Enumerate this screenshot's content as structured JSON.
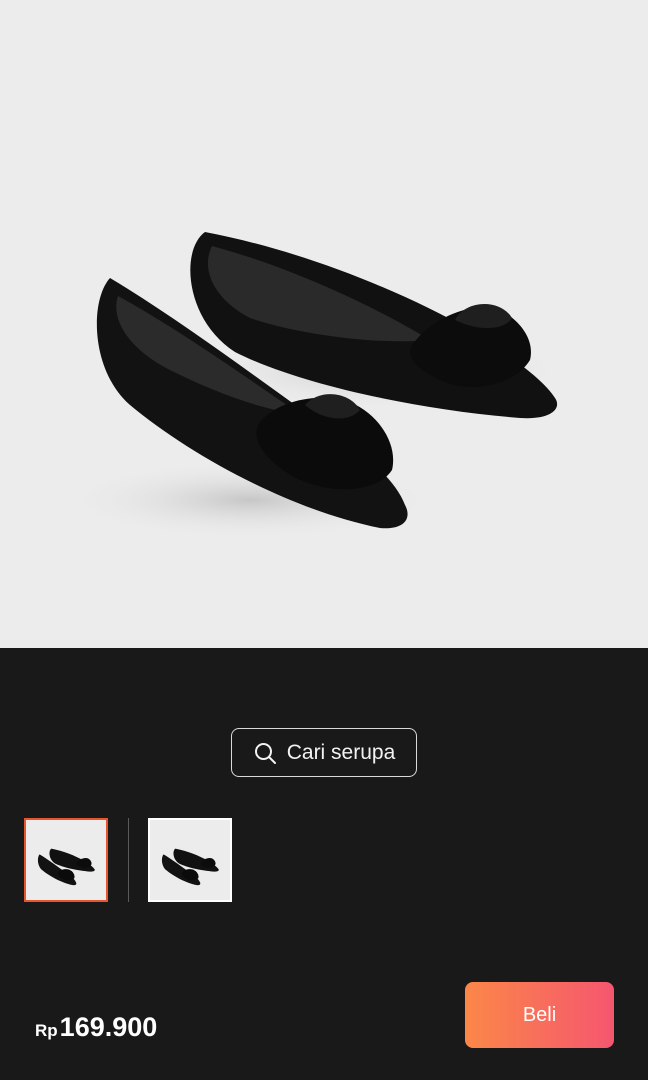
{
  "product": {
    "image_icon": "black-pointed-flat-shoes-with-bow",
    "thumbnails": [
      {
        "selected": true
      },
      {
        "selected": false
      }
    ]
  },
  "search_similar": {
    "label": "Cari serupa",
    "icon": "search-icon"
  },
  "footer": {
    "currency": "Rp",
    "price": "169.900",
    "buy_label": "Beli"
  },
  "colors": {
    "background": "#191919",
    "image_background": "#ececec",
    "selected_border": "#e4572e",
    "buy_gradient_start": "#fb8748",
    "buy_gradient_end": "#f5566f"
  }
}
